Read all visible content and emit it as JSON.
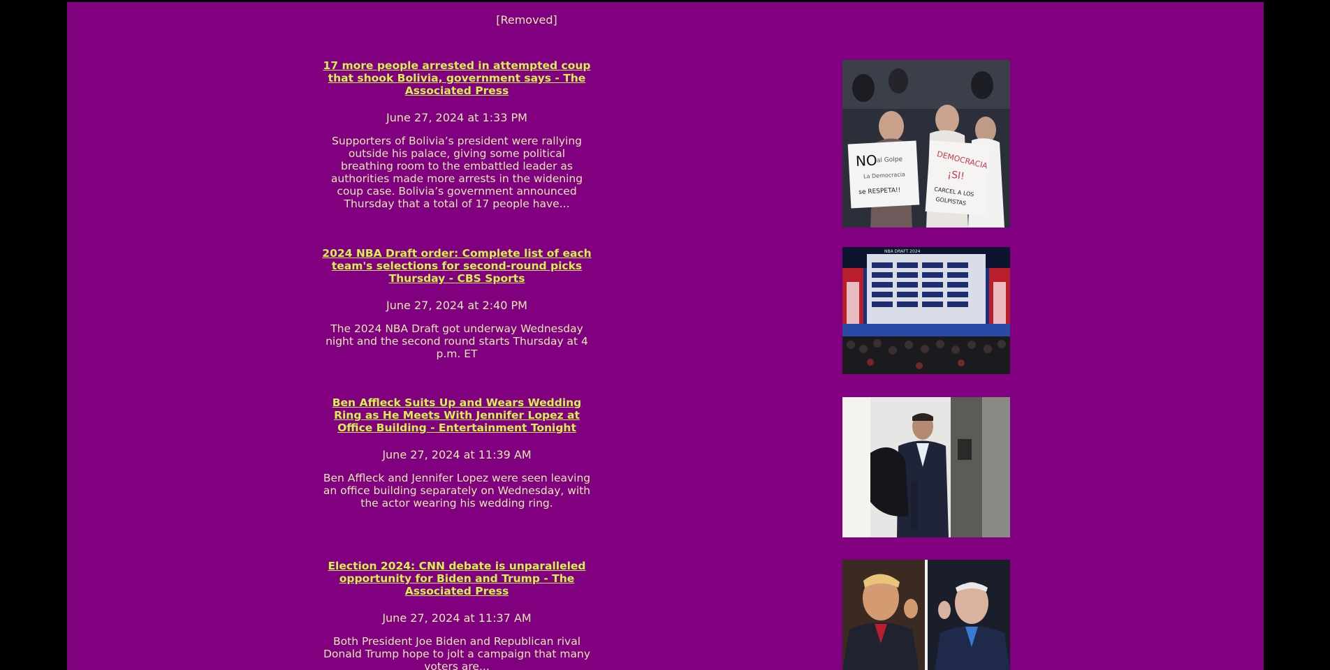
{
  "top_notice": "[Removed]",
  "articles": [
    {
      "headline": "17 more people arrested in attempted coup that shook Bolivia, government says - The Associated Press",
      "date": "June 27, 2024 at 1:33 PM",
      "description": "Supporters of Bolivia’s president were rallying outside his palace, giving some political breathing room to the embattled leader as authorities made more arrests in the widening coup case. Bolivia’s government announced Thursday that a total of 17 people have...",
      "image_icon": "protest-photo",
      "sign_left": "NO al Golpe / La Democracia se RESPETA!!",
      "sign_right": "DEMOCRACIA ¡SI! CARCEL A LOS GOLPISTAS"
    },
    {
      "headline": "2024 NBA Draft order: Complete list of each team's selections for second-round picks Thursday - CBS Sports",
      "date": "June 27, 2024 at 2:40 PM",
      "description": "The 2024 NBA Draft got underway Wednesday night and the second round starts Thursday at 4 p.m. ET",
      "image_icon": "nba-draft-stage-photo",
      "stage_text": "NBA DRAFT 2024"
    },
    {
      "headline": "Ben Affleck Suits Up and Wears Wedding Ring as He Meets With Jennifer Lopez at Office Building - Entertainment Tonight",
      "date": "June 27, 2024 at 11:39 AM",
      "description": "Ben Affleck and Jennifer Lopez were seen leaving an office building separately on Wednesday, with the actor wearing his wedding ring.",
      "image_icon": "man-in-suit-photo"
    },
    {
      "headline": "Election 2024: CNN debate is unparalleled opportunity for Biden and Trump - The Associated Press",
      "date": "June 27, 2024 at 11:37 AM",
      "description": "Both President Joe Biden and Republican rival Donald Trump hope to jolt a campaign that many voters are...",
      "image_icon": "two-candidates-photo"
    }
  ],
  "colors": {
    "page_bg": "#800080",
    "outer_bg": "#000000",
    "link": "#d6f04e",
    "text": "#e9e9b0"
  }
}
